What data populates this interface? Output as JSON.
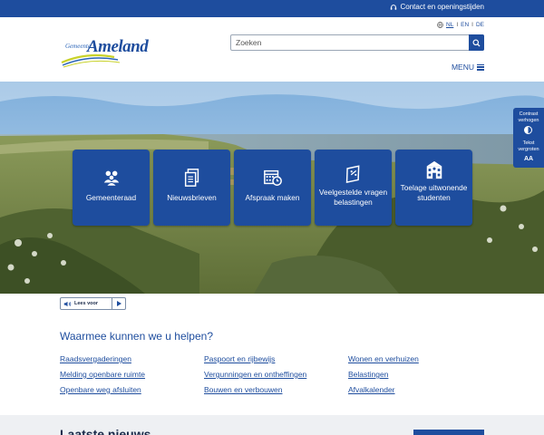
{
  "topbar": {
    "contact_label": "Contact en openingstijden",
    "contact_icon": "headset-icon"
  },
  "languages": {
    "items": [
      "NL",
      "EN",
      "DE"
    ],
    "active": "NL",
    "icon": "globe-icon"
  },
  "logo": {
    "gemeente": "Gemeente",
    "name": "Ameland"
  },
  "search": {
    "placeholder": "Zoeken",
    "value": "",
    "icon": "search-icon"
  },
  "menu": {
    "label": "MENU",
    "icon": "hamburger-icon"
  },
  "tiles": [
    {
      "label": "Gemeenteraad",
      "icon": "people-group-icon"
    },
    {
      "label": "Nieuwsbrieven",
      "icon": "documents-icon"
    },
    {
      "label": "Afspraak maken",
      "icon": "calendar-clock-icon"
    },
    {
      "label": "Veelgestelde vragen belastingen",
      "icon": "tax-receipt-icon"
    },
    {
      "label": "Toelage uitwonende studenten",
      "icon": "school-building-icon"
    }
  ],
  "accessibility": {
    "contrast_label": "Contrast verhogen",
    "text_label": "Tekst vergroten",
    "text_icon_label": "AA"
  },
  "readaloud": {
    "label": "Lees voor",
    "play_icon": "play-icon",
    "speaker_icon": "speaker-icon"
  },
  "help": {
    "title": "Waarmee kunnen we u helpen?",
    "columns": [
      [
        "Raadsvergaderingen",
        "Melding openbare ruimte",
        "Openbare weg afsluiten"
      ],
      [
        "Paspoort en rijbewijs",
        "Vergunningen en ontheffingen",
        "Bouwen en verbouwen"
      ],
      [
        "Wonen en verhuizen",
        "Belastingen",
        "Afvalkalender"
      ]
    ]
  },
  "bottom": {
    "title": "Laatste nieuws"
  },
  "colors": {
    "brand_blue": "#1e4d9e",
    "accent_yellow": "#c9d22a"
  }
}
